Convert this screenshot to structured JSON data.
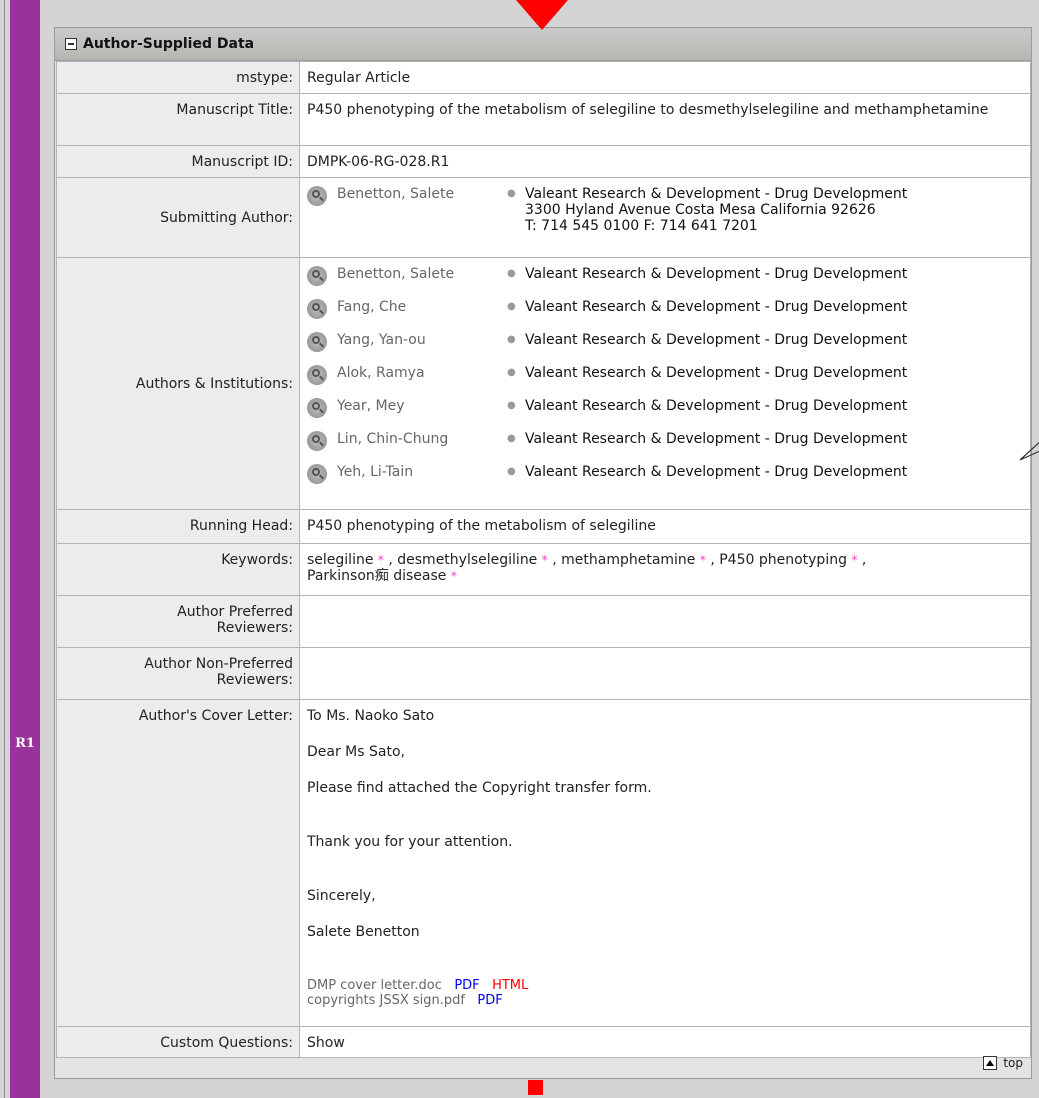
{
  "revision_label": "R1",
  "panel": {
    "title": "Author-Supplied Data"
  },
  "rows": {
    "mstype": {
      "label": "mstype:",
      "value": "Regular Article"
    },
    "title": {
      "label": "Manuscript Title:",
      "value": "P450 phenotyping of the metabolism of selegiline to desmethylselegiline and methamphetamine"
    },
    "ms_id": {
      "label": "Manuscript ID:",
      "value": "DMPK-06-RG-028.R1"
    },
    "submitting": {
      "label": "Submitting Author:",
      "name": "Benetton, Salete",
      "inst_line1": "Valeant Research & Development - Drug Development",
      "inst_line2": "3300 Hyland Avenue Costa Mesa California 92626",
      "inst_line3": "T: 714 545 0100 F: 714 641 7201"
    },
    "authors": {
      "label": "Authors & Institutions:",
      "list": [
        {
          "name": "Benetton, Salete",
          "inst": "Valeant Research & Development - Drug Development"
        },
        {
          "name": "Fang, Che",
          "inst": "Valeant Research & Development - Drug Development"
        },
        {
          "name": "Yang, Yan-ou",
          "inst": "Valeant Research & Development - Drug Development"
        },
        {
          "name": "Alok, Ramya",
          "inst": "Valeant Research & Development - Drug Development"
        },
        {
          "name": "Year, Mey",
          "inst": "Valeant Research & Development - Drug Development"
        },
        {
          "name": "Lin, Chin-Chung",
          "inst": "Valeant Research & Development - Drug Development"
        },
        {
          "name": "Yeh, Li-Tain",
          "inst": "Valeant Research & Development - Drug Development"
        }
      ]
    },
    "running_head": {
      "label": "Running Head:",
      "value": "P450 phenotyping of the metabolism of selegiline"
    },
    "keywords": {
      "label": "Keywords:",
      "items": [
        "selegiline",
        "desmethylselegiline",
        "methamphetamine",
        "P450 phenotyping",
        "Parkinson痴 disease"
      ],
      "star": "*",
      "separator": " , "
    },
    "preferred": {
      "label_line1": "Author Preferred",
      "label_line2": "Reviewers:"
    },
    "non_preferred": {
      "label_line1": "Author Non-Preferred",
      "label_line2": "Reviewers:"
    },
    "cover": {
      "label": "Author's Cover Letter:",
      "p1": "To Ms. Naoko Sato",
      "p2": "Dear Ms Sato,",
      "p3": "Please find attached the Copyright transfer form.",
      "p4": "Thank you for your attention.",
      "p5": "Sincerely,",
      "p6": "Salete Benetton",
      "file1": "DMP cover letter.doc",
      "file1_pdf": "PDF",
      "file1_html": "HTML",
      "file2": "copyrights JSSX sign.pdf",
      "file2_pdf": "PDF"
    },
    "custom": {
      "label": "Custom Questions:",
      "value": "Show"
    }
  },
  "footer": {
    "top_label": "top"
  },
  "colors": {
    "revision_bar": "#993399",
    "marker_red": "#ff0000",
    "keyword_star": "#ff3bd1",
    "link_blue": "#0000ee",
    "link_red": "#ff0000"
  }
}
